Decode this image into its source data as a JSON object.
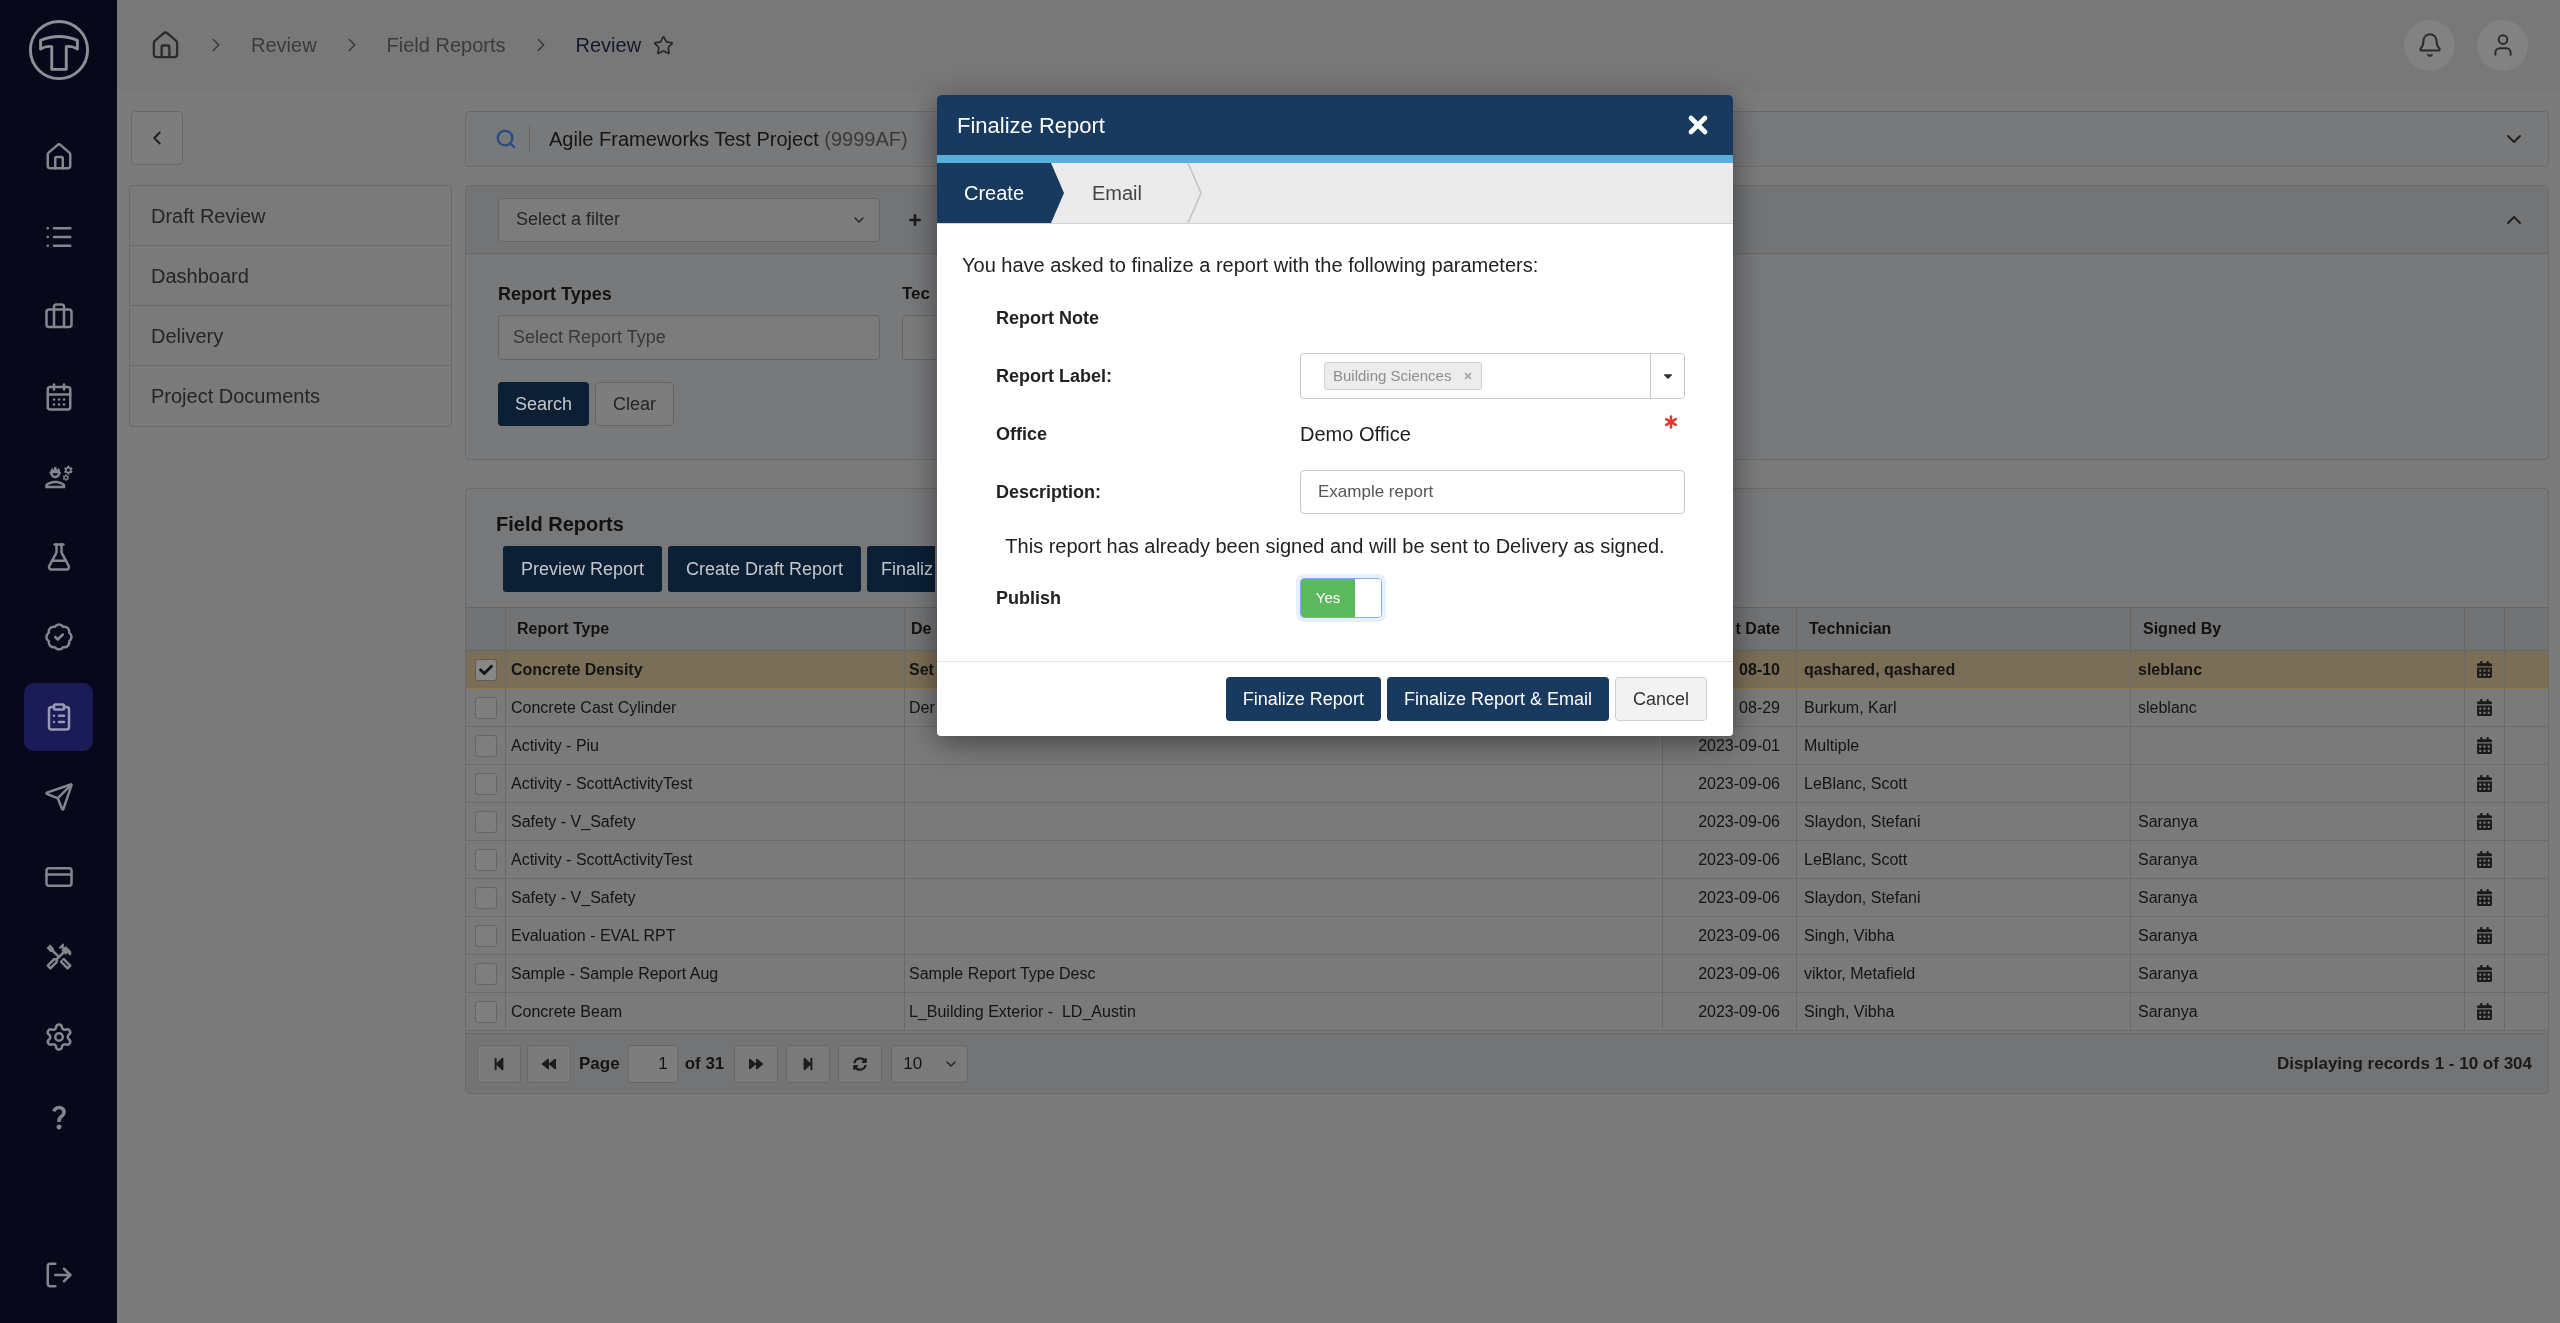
{
  "sidebar": {
    "items": [
      {
        "selected": false
      },
      {
        "selected": false
      },
      {
        "selected": false
      },
      {
        "selected": false
      },
      {
        "selected": false
      },
      {
        "selected": false
      },
      {
        "selected": false
      },
      {
        "selected": true
      },
      {
        "selected": false
      },
      {
        "selected": false
      },
      {
        "selected": false
      },
      {
        "selected": false
      },
      {
        "selected": false
      }
    ],
    "bottom_items": [
      {
        "selected": false
      }
    ]
  },
  "header": {
    "breadcrumb": [
      {
        "label": "Review",
        "current": false
      },
      {
        "label": "Field Reports",
        "current": false
      },
      {
        "label": "Review",
        "current": true
      }
    ]
  },
  "left_menu": {
    "items": [
      "Draft Review",
      "Dashboard",
      "Delivery",
      "Project Documents"
    ]
  },
  "project_bar": {
    "name": "Agile Frameworks Test Project",
    "code": "(9999AF)"
  },
  "filters": {
    "filter_select": {
      "placeholder": "Select a filter"
    },
    "fields": [
      {
        "label": "Report Types",
        "placeholder": "Select Report Type"
      },
      {
        "label": "Tec"
      }
    ],
    "buttons": [
      {
        "label": "Search",
        "kind": "primary"
      },
      {
        "label": "Clear",
        "kind": "secondary"
      }
    ]
  },
  "field_reports": {
    "title": "Field Reports",
    "toolbar": [
      "Preview Report",
      "Create Draft Report",
      "Finaliz"
    ],
    "table": {
      "columns": [
        "Report Type",
        "De",
        "t Date",
        "Technician",
        "Signed By"
      ],
      "rows": [
        {
          "selected": true,
          "report_type": "Concrete Density",
          "column_2": "Set",
          "column_3": "08-10",
          "technician": "qashared, qashared",
          "signed_by": "sleblanc"
        },
        {
          "selected": false,
          "report_type": "Concrete Cast Cylinder",
          "column_2": "Der",
          "column_3": "08-29",
          "technician": "Burkum, Karl",
          "signed_by": "sleblanc"
        },
        {
          "selected": false,
          "report_type": "Activity - Piu",
          "column_3": "2023-09-01",
          "technician": "Multiple"
        },
        {
          "selected": false,
          "report_type": "Activity - ScottActivityTest",
          "column_3": "2023-09-06",
          "technician": "LeBlanc, Scott"
        },
        {
          "selected": false,
          "report_type": "Safety - V_Safety",
          "column_3": "2023-09-06",
          "technician": "Slaydon, Stefani",
          "signed_by": "Saranya"
        },
        {
          "selected": false,
          "report_type": "Activity - ScottActivityTest",
          "column_3": "2023-09-06",
          "technician": "LeBlanc, Scott",
          "signed_by": "Saranya"
        },
        {
          "selected": false,
          "report_type": "Safety - V_Safety",
          "column_3": "2023-09-06",
          "technician": "Slaydon, Stefani",
          "signed_by": "Saranya"
        },
        {
          "selected": false,
          "report_type": "Evaluation - EVAL RPT",
          "column_3": "2023-09-06",
          "technician": "Singh, Vibha",
          "signed_by": "Saranya"
        },
        {
          "selected": false,
          "report_type": "Sample - Sample Report Aug",
          "column_2": "Sample Report Type Desc",
          "column_3": "2023-09-06",
          "technician": "viktor, Metafield",
          "signed_by": "Saranya"
        },
        {
          "selected": false,
          "report_type": "Concrete Beam",
          "column_2": "L_Building Exterior -  LD_Austin",
          "column_3": "2023-09-06",
          "technician": "Singh, Vibha",
          "signed_by": "Saranya"
        }
      ]
    },
    "pagination": {
      "page_label": "Page",
      "page": "1",
      "of_label": "of 31",
      "page_size": "10",
      "summary": "Displaying records 1 - 10 of 304"
    }
  },
  "modal": {
    "title": "Finalize Report",
    "steps": [
      {
        "label": "Create",
        "selected": true
      },
      {
        "label": "Email",
        "selected": false
      }
    ],
    "intro": "You have asked to finalize a report with the following parameters:",
    "rows": [
      {
        "kind": "note",
        "label": "Report Note"
      },
      {
        "kind": "tags",
        "label": "Report Label:",
        "tags": [
          "Building Sciences"
        ]
      },
      {
        "kind": "static",
        "label": "Office",
        "value": "Demo Office",
        "required": true
      },
      {
        "kind": "input",
        "label": "Description:",
        "value": "Example report"
      },
      {
        "kind": "notice",
        "text": "This report has already been signed and will be sent to Delivery as signed."
      },
      {
        "kind": "toggle",
        "label": "Publish",
        "on": true,
        "text": "Yes"
      }
    ],
    "buttons": [
      {
        "label": "Finalize Report",
        "kind": "primary"
      },
      {
        "label": "Finalize Report & Email",
        "kind": "primary"
      },
      {
        "label": "Cancel",
        "kind": "secondary"
      }
    ]
  }
}
